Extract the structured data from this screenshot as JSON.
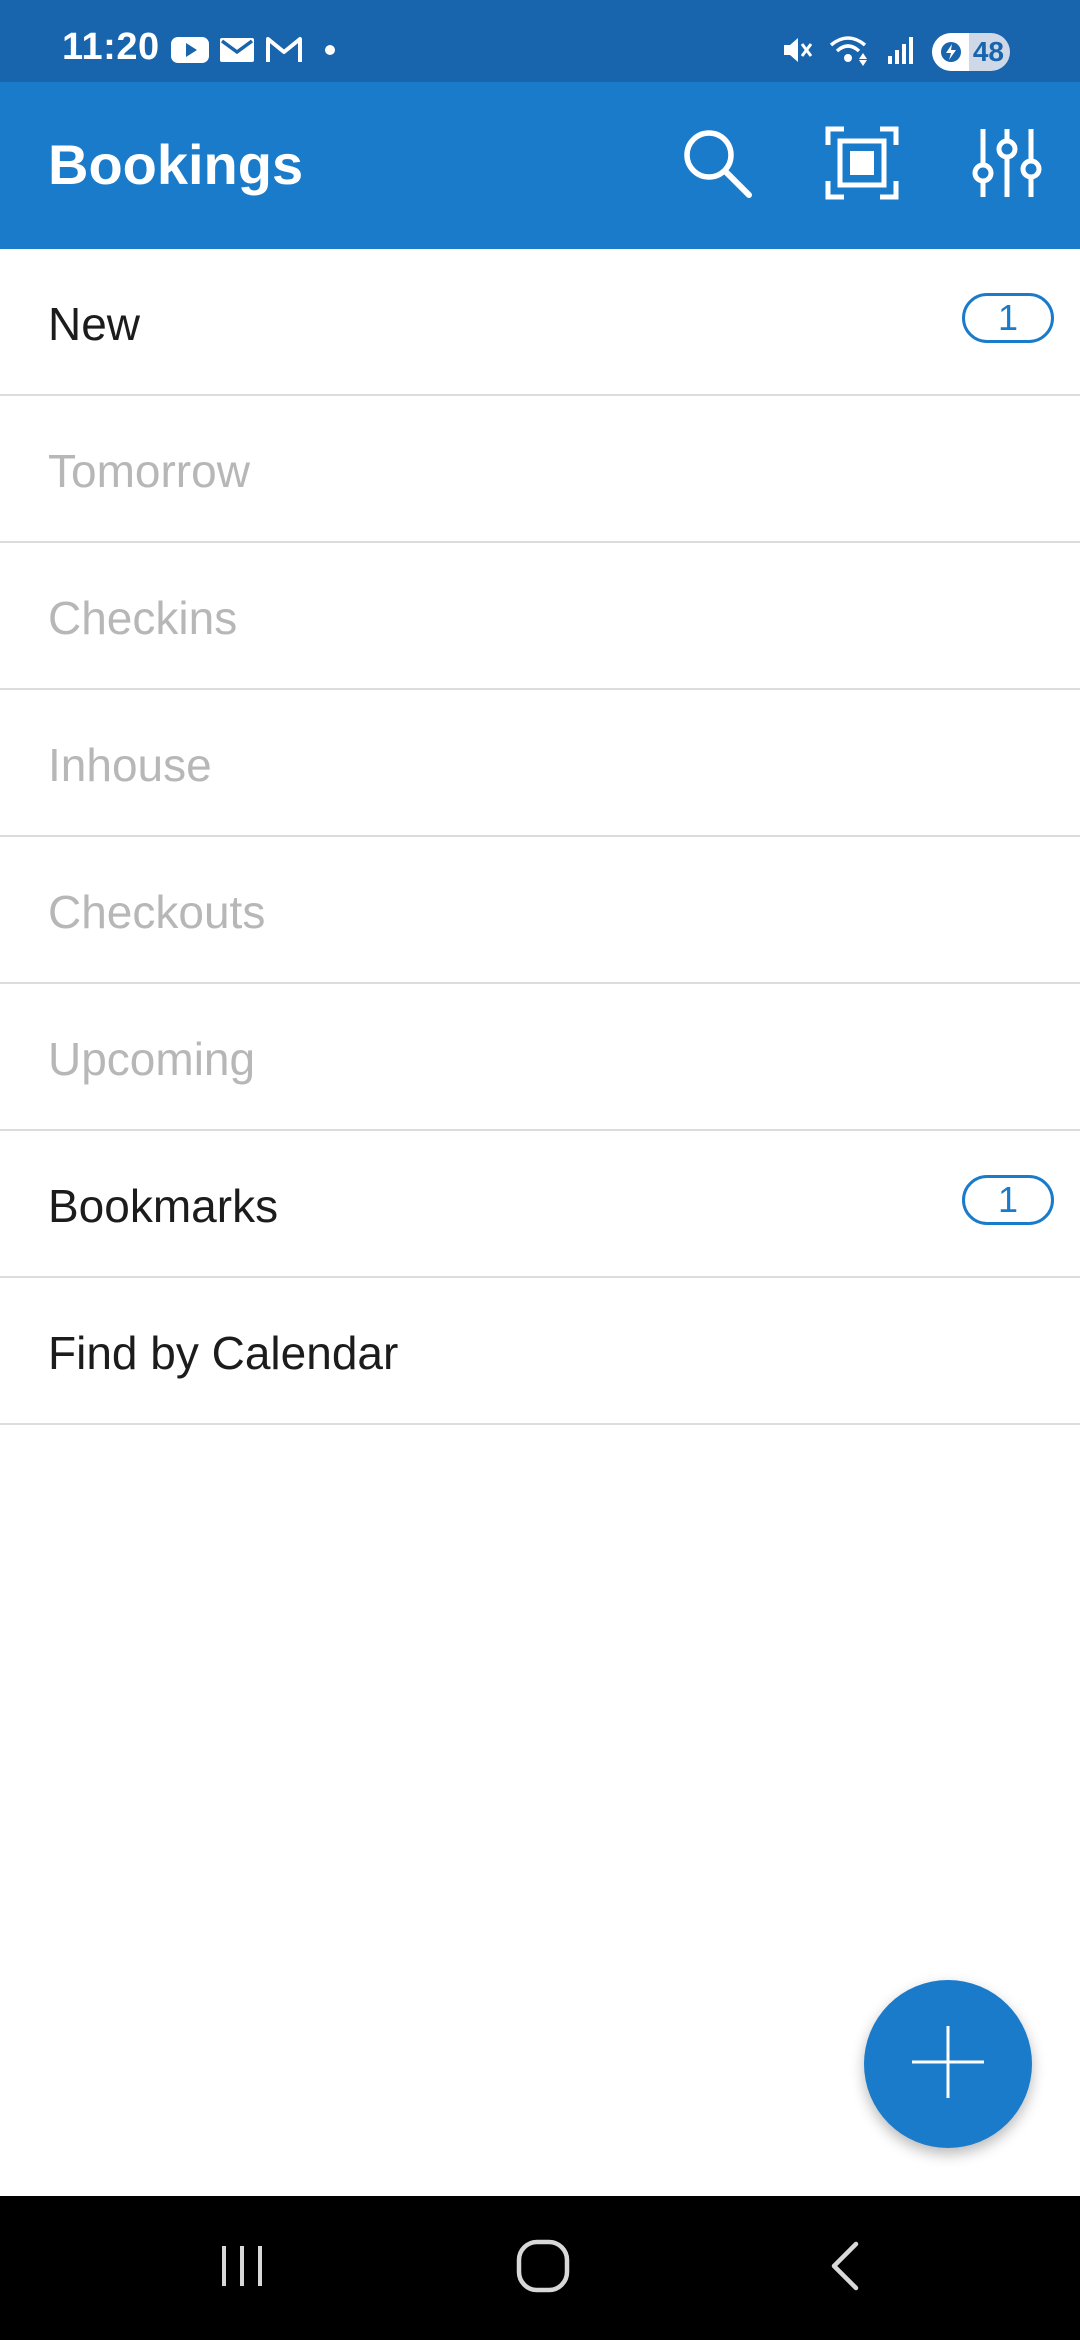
{
  "status_bar": {
    "time": "11:20",
    "battery_level": "48",
    "battery_fraction": 0.48,
    "left_icons": [
      "youtube-icon",
      "gmail-icon",
      "gmail-outline-icon",
      "dot-icon"
    ],
    "right_icons": [
      "mute-icon",
      "wifi-icon",
      "signal-icon",
      "battery-icon"
    ]
  },
  "app_bar": {
    "title": "Bookings",
    "actions": [
      "search-icon",
      "scan-icon",
      "filter-sliders-icon"
    ]
  },
  "list": {
    "items": [
      {
        "label": "New",
        "badge": "1",
        "enabled": true
      },
      {
        "label": "Tomorrow",
        "badge": null,
        "enabled": false
      },
      {
        "label": "Checkins",
        "badge": null,
        "enabled": false
      },
      {
        "label": "Inhouse",
        "badge": null,
        "enabled": false
      },
      {
        "label": "Checkouts",
        "badge": null,
        "enabled": false
      },
      {
        "label": "Upcoming",
        "badge": null,
        "enabled": false
      },
      {
        "label": "Bookmarks",
        "badge": "1",
        "enabled": true
      },
      {
        "label": "Find by Calendar",
        "badge": null,
        "enabled": true
      }
    ]
  },
  "fab": {
    "icon": "plus-icon"
  },
  "nav_bar": {
    "buttons": [
      "recents-icon",
      "home-icon",
      "back-icon"
    ]
  },
  "colors": {
    "status_bar": "#1864ad",
    "app_bar": "#1a7bcb",
    "accent": "#1a7bcb",
    "text_enabled": "#1c1c1c",
    "text_disabled": "#b7b7b7",
    "divider": "#dcdcdc"
  }
}
